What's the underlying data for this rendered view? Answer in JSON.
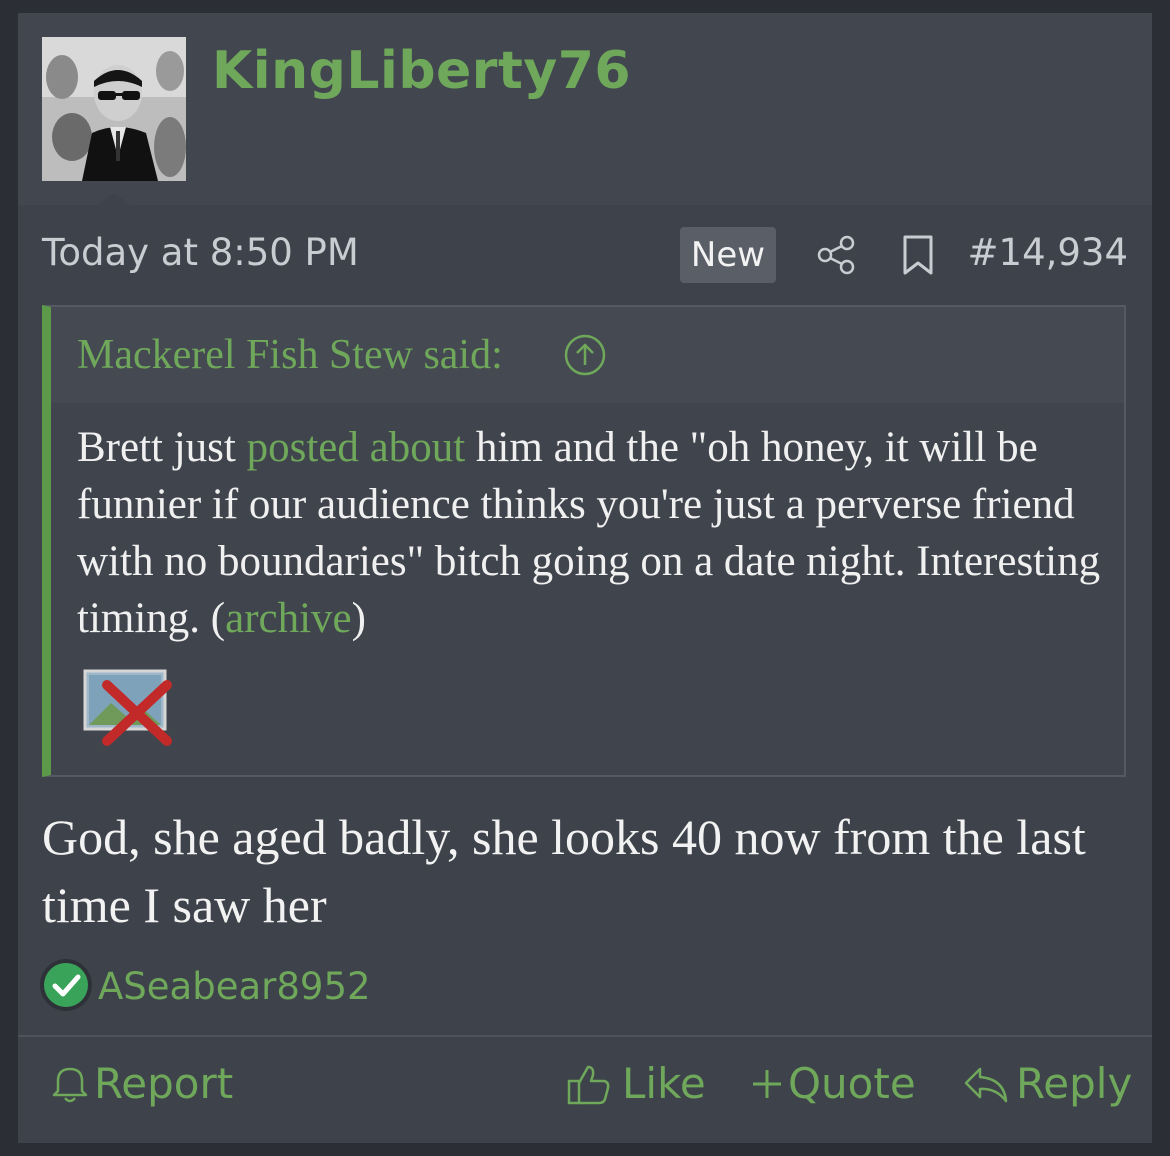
{
  "post": {
    "username": "KingLiberty76",
    "avatar_icon": "user-avatar-photo",
    "timestamp": "Today at 8:50 PM",
    "badge": "New",
    "share_icon": "share-icon",
    "bookmark_icon": "bookmark-icon",
    "post_number": "#14,934",
    "quote": {
      "attribution": "Mackerel Fish Stew said:",
      "up_icon": "arrow-up-circle-icon",
      "text_1": "Brett just ",
      "link_1": "posted about",
      "text_2": " him and the \"oh honey, it will be funnier if our audience thinks you're just a perverse friend with no boundaries\" bitch going on a date night. Interesting timing. (",
      "link_2": "archive",
      "text_3": ")",
      "image_icon": "broken-image-icon"
    },
    "message": "God, she aged badly, she looks 40 now from the last time I saw her",
    "reaction": {
      "icon": "checkmark-reaction-icon",
      "user": "ASeabear8952"
    },
    "actions": {
      "report": "Report",
      "like": "Like",
      "quote": "Quote",
      "reply": "Reply"
    }
  },
  "colors": {
    "accent": "#6fa85a",
    "background": "#3e434b",
    "text": "#f0f0f0"
  }
}
